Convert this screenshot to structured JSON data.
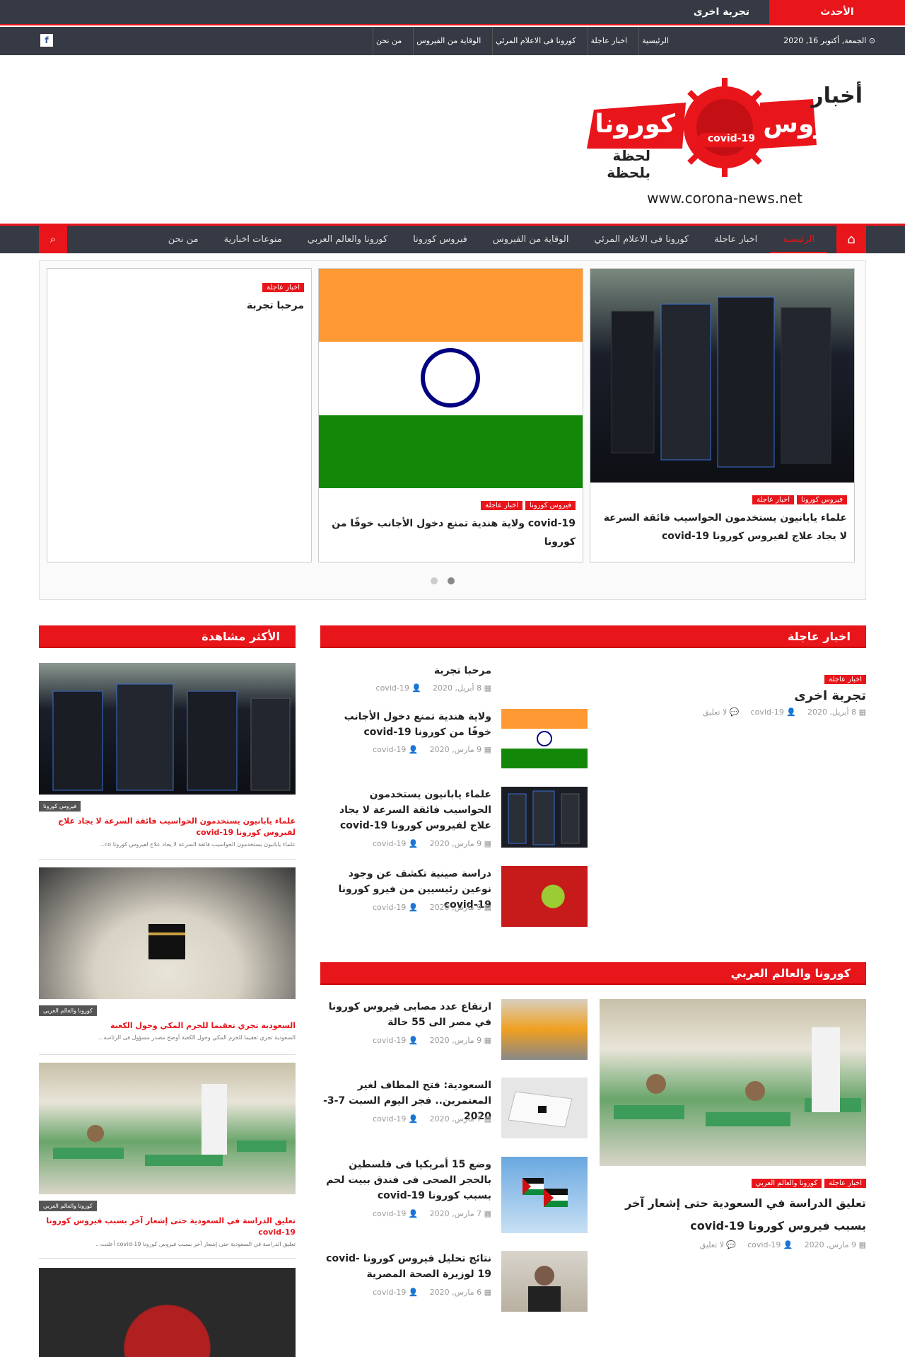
{
  "ticker": {
    "label": "الأحدث",
    "text": "تجربة اخرى"
  },
  "topbar": {
    "date": "الجمعة, أكتوبر 16, 2020",
    "links": [
      "الرئيسية",
      "اخبار عاجلة",
      "كورونا فى الاعلام المرئي",
      "الوقاية من الفيروس",
      "من نحن"
    ]
  },
  "logo": {
    "line1": "أخبار",
    "line2": "فيروس",
    "line3": "كورونا",
    "line4": "لحظة بلحظة",
    "badge": "covid-19",
    "url": "www.corona-news.net"
  },
  "nav": {
    "items": [
      "الرئيسية",
      "اخبار عاجلة",
      "كورونا فى الاعلام المرئي",
      "الوقاية من الفيروس",
      "فيروس كورونا",
      "كورونا والعالم العربي",
      "منوعات اخبارية",
      "من نحن"
    ]
  },
  "slider": {
    "slides": [
      {
        "tags": [
          "فيروس كورونا",
          "اخبار عاجلة"
        ],
        "title": "علماء يابانيون يستخدمون الحواسيب فائقة السرعة لا يجاد علاج لفيروس كورونا covid-19"
      },
      {
        "tags": [
          "فيروس كورونا",
          "اخبار عاجلة"
        ],
        "title": "covid-19 ولاية هندية تمنع دخول الأجانب خوفًا من كورونا"
      },
      {
        "tags": [
          "اخبار عاجلة"
        ],
        "title": "مرحبا تجربة"
      }
    ]
  },
  "breaking": {
    "heading": "اخبار عاجلة",
    "main": {
      "tag": "اخبار عاجلة",
      "title": "تجربة اخرى",
      "date": "8 أبريل, 2020",
      "author": "covid-19",
      "comments": "لا تعليق"
    },
    "list": [
      {
        "title": "مرحبا تجربة",
        "date": "8 أبريل, 2020",
        "author": "covid-19"
      },
      {
        "title": "ولاية هندية تمنع دخول الأجانب خوفًا من كورونا covid-19",
        "date": "9 مارس, 2020",
        "author": "covid-19"
      },
      {
        "title": "علماء يابانيون يستخدمون الحواسيب فائقة السرعة لا يجاد علاج لفيروس كورونا covid-19",
        "date": "9 مارس, 2020",
        "author": "covid-19"
      },
      {
        "title": "دراسة صينية تكشف عن وجود نوعين رئيسيين من فيرو كورونا covid-19",
        "date": "9 مارس, 2020",
        "author": "covid-19"
      }
    ]
  },
  "arab": {
    "heading": "كورونا والعالم العربي",
    "main": {
      "tags": [
        "كورونا والعالم العربي",
        "اخبار عاجلة"
      ],
      "title": "تعليق الدراسة في السعودية حتى إشعار آخر بسبب فيروس كورونا covid-19",
      "date": "9 مارس, 2020",
      "author": "covid-19",
      "comments": "لا تعليق"
    },
    "list": [
      {
        "title": "ارتفاع عدد مصابى فيروس كورونا في مصر الى 55 حالة",
        "date": "9 مارس, 2020",
        "author": "covid-19"
      },
      {
        "title": "السعودية: فتح المطاف لغير المعتمرين.. فجر اليوم السبت 7-3-2020",
        "date": "7 مارس, 2020",
        "author": "covid-19"
      },
      {
        "title": "وضع 15 أمريكيا فى فلسطين بالحجر الصحى فى فندق ببيت لحم بسبب كورونا covid-19",
        "date": "7 مارس, 2020",
        "author": "covid-19"
      },
      {
        "title": "نتائج تحليل فيروس كورونا covid-19 لوزيرة الصحة المصرية",
        "date": "6 مارس, 2020",
        "author": "covid-19"
      }
    ]
  },
  "most": {
    "heading": "الأكثر مشاهدة",
    "cards": [
      {
        "tag": "فيروس كورونا",
        "title": "علماء يابانيون يستخدمون الحواسيب فائقة السرعة لا يجاد علاج لفيروس كورونا covid-19",
        "excerpt": "علماء يابانيون يستخدمون الحواسيب فائقة السرعة لا يجاد علاج لفيروس كورونا co..."
      },
      {
        "tag": "كورونا والعالم العربي",
        "title": "السعودية تجري تعقيما للحرم المكي وحول الكعبة",
        "excerpt": "السعودية تجري تعقيما للحرم المكي وحول الكعبة أوضح مصدر مسؤول فى الرئاسة..."
      },
      {
        "tag": "كورونا والعالم العربي",
        "title": "تعليق الدراسة في السعودية حتى إشعار آخر بسبب فيروس كورونا covid-19",
        "excerpt": "تعليق الدراسة في السعودية حتى إشعار آخر بسبب فيروس كورونا covid-19 أعلنت..."
      }
    ]
  },
  "colors": {
    "accent": "#e8151b",
    "dark": "#353a44"
  }
}
